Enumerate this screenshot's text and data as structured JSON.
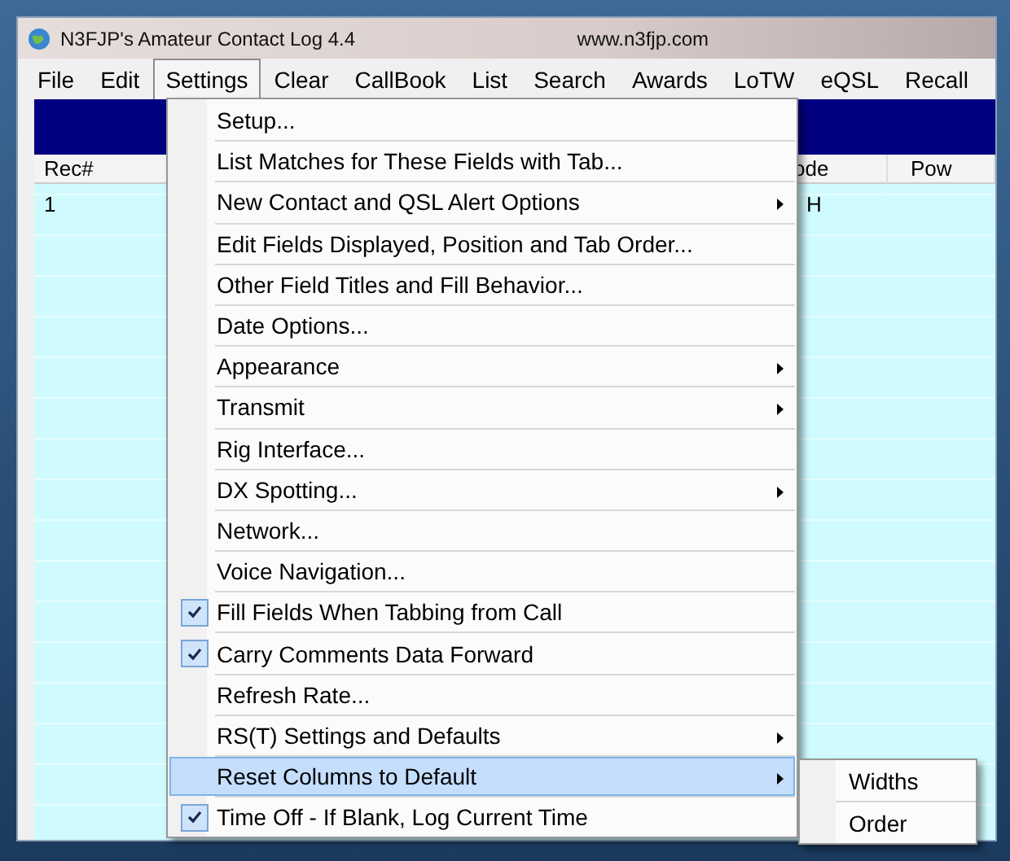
{
  "window": {
    "title": "N3FJP's Amateur Contact Log 4.4",
    "website": "www.n3fjp.com"
  },
  "menubar": [
    {
      "label": "File",
      "selected": false
    },
    {
      "label": "Edit",
      "selected": false
    },
    {
      "label": "Settings",
      "selected": true
    },
    {
      "label": "Clear",
      "selected": false
    },
    {
      "label": "CallBook",
      "selected": false
    },
    {
      "label": "List",
      "selected": false
    },
    {
      "label": "Search",
      "selected": false
    },
    {
      "label": "Awards",
      "selected": false
    },
    {
      "label": "LoTW",
      "selected": false
    },
    {
      "label": "eQSL",
      "selected": false
    },
    {
      "label": "Recall",
      "selected": false
    }
  ],
  "table": {
    "columns": [
      "Rec#",
      "ode",
      "Pow"
    ],
    "rows": [
      [
        "1",
        "H",
        ""
      ]
    ]
  },
  "settings_menu": [
    {
      "label": "Setup...",
      "checked": false,
      "submenu": false,
      "selected": false
    },
    {
      "label": "List Matches for These Fields with Tab...",
      "checked": false,
      "submenu": false,
      "selected": false
    },
    {
      "label": "New Contact and QSL Alert Options",
      "checked": false,
      "submenu": true,
      "selected": false
    },
    {
      "label": "Edit Fields Displayed, Position and Tab Order...",
      "checked": false,
      "submenu": false,
      "selected": false
    },
    {
      "label": "Other Field Titles and Fill Behavior...",
      "checked": false,
      "submenu": false,
      "selected": false
    },
    {
      "label": "Date Options...",
      "checked": false,
      "submenu": false,
      "selected": false
    },
    {
      "label": "Appearance",
      "checked": false,
      "submenu": true,
      "selected": false
    },
    {
      "label": "Transmit",
      "checked": false,
      "submenu": true,
      "selected": false
    },
    {
      "label": "Rig Interface...",
      "checked": false,
      "submenu": false,
      "selected": false
    },
    {
      "label": "DX Spotting...",
      "checked": false,
      "submenu": true,
      "selected": false
    },
    {
      "label": "Network...",
      "checked": false,
      "submenu": false,
      "selected": false
    },
    {
      "label": "Voice Navigation...",
      "checked": false,
      "submenu": false,
      "selected": false
    },
    {
      "label": "Fill Fields When Tabbing from Call",
      "checked": true,
      "submenu": false,
      "selected": false
    },
    {
      "label": "Carry Comments Data Forward",
      "checked": true,
      "submenu": false,
      "selected": false
    },
    {
      "label": "Refresh Rate...",
      "checked": false,
      "submenu": false,
      "selected": false
    },
    {
      "label": "RS(T) Settings and Defaults",
      "checked": false,
      "submenu": true,
      "selected": false
    },
    {
      "label": "Reset Columns to Default",
      "checked": false,
      "submenu": true,
      "selected": true
    },
    {
      "label": "Time Off - If Blank, Log Current Time",
      "checked": true,
      "submenu": false,
      "selected": false
    }
  ],
  "submenu": [
    "Widths",
    "Order"
  ]
}
